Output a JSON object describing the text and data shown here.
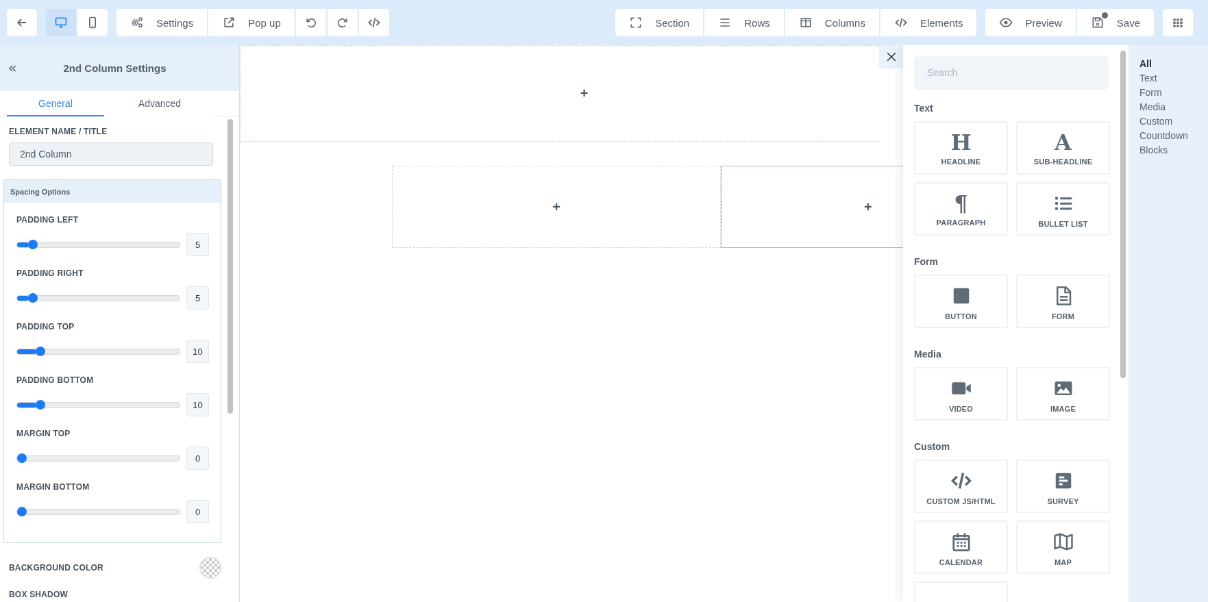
{
  "toolbar": {
    "left_groups": [
      {
        "buttons": [
          {
            "kind": "back"
          }
        ]
      },
      {
        "buttons": [
          {
            "kind": "desktop",
            "selected": true
          },
          {
            "kind": "mobile",
            "selected": false
          }
        ]
      },
      {
        "buttons": [
          {
            "kind": "gears",
            "label": "Settings"
          },
          {
            "kind": "popup",
            "label": "Pop up"
          },
          {
            "kind": "undo"
          },
          {
            "kind": "redo"
          },
          {
            "kind": "code"
          }
        ]
      }
    ],
    "right_groups": [
      {
        "buttons": [
          {
            "kind": "section",
            "label": "Section"
          },
          {
            "kind": "rows",
            "label": "Rows"
          },
          {
            "kind": "columns",
            "label": "Columns"
          },
          {
            "kind": "code",
            "label": "Elements"
          }
        ]
      },
      {
        "buttons": [
          {
            "kind": "eye",
            "label": "Preview"
          },
          {
            "kind": "save",
            "label": "Save",
            "unsaved": true
          }
        ]
      },
      {
        "buttons": [
          {
            "kind": "grid"
          }
        ]
      }
    ]
  },
  "settings": {
    "title": "2nd Column Settings",
    "tabs": [
      {
        "label": "General",
        "selected": true
      },
      {
        "label": "Advanced",
        "selected": false
      }
    ],
    "name_field": {
      "label": "ELEMENT NAME / TITLE",
      "value": "2nd Column"
    },
    "spacing": {
      "title": "Spacing Options",
      "sliders": [
        {
          "label": "PADDING LEFT",
          "level": 0.07,
          "value": "5"
        },
        {
          "label": "PADDING RIGHT",
          "level": 0.07,
          "value": "5"
        },
        {
          "label": "PADDING TOP",
          "level": 0.12,
          "value": "10"
        },
        {
          "label": "PADDING BOTTOM",
          "level": 0.12,
          "value": "10"
        },
        {
          "label": "MARGIN TOP",
          "level": 0,
          "value": "0"
        },
        {
          "label": "MARGIN BOTTOM",
          "level": 0,
          "value": "0"
        }
      ]
    },
    "background_color": {
      "label": "BACKGROUND COLOR",
      "transparent": true
    },
    "box_shadow": {
      "label": "BOX SHADOW"
    }
  },
  "canvas": {
    "section": {
      "add": "+"
    },
    "row": {
      "columns": [
        {
          "add": "+",
          "selected": false
        },
        {
          "add": "+",
          "selected": true
        }
      ]
    }
  },
  "elements_panel": {
    "search_placeholder": "Search",
    "groups": [
      {
        "title": "Text",
        "items": [
          {
            "kind": "glyph",
            "glyph": "H",
            "label": "HEADLINE"
          },
          {
            "kind": "glyph",
            "glyph": "A",
            "label": "SUB-HEADLINE"
          },
          {
            "kind": "glyph",
            "glyph": "¶",
            "label": "PARAGRAPH"
          },
          {
            "kind": "list",
            "label": "BULLET LIST"
          }
        ]
      },
      {
        "title": "Form",
        "items": [
          {
            "kind": "square",
            "label": "BUTTON"
          },
          {
            "kind": "doc",
            "label": "FORM"
          }
        ]
      },
      {
        "title": "Media",
        "items": [
          {
            "kind": "video",
            "label": "VIDEO"
          },
          {
            "kind": "image",
            "label": "IMAGE"
          }
        ]
      },
      {
        "title": "Custom",
        "items": [
          {
            "kind": "code",
            "label": "CUSTOM JS/HTML"
          },
          {
            "kind": "survey",
            "label": "SURVEY"
          },
          {
            "kind": "calendar",
            "label": "CALENDAR"
          },
          {
            "kind": "map",
            "label": "MAP"
          },
          {
            "kind": "blank"
          }
        ]
      }
    ]
  },
  "categories": [
    {
      "label": "All",
      "selected": true
    },
    {
      "label": "Text",
      "selected": false
    },
    {
      "label": "Form",
      "selected": false
    },
    {
      "label": "Media",
      "selected": false
    },
    {
      "label": "Custom",
      "selected": false
    },
    {
      "label": "Countdown",
      "selected": false
    },
    {
      "label": "Blocks",
      "selected": false
    }
  ]
}
